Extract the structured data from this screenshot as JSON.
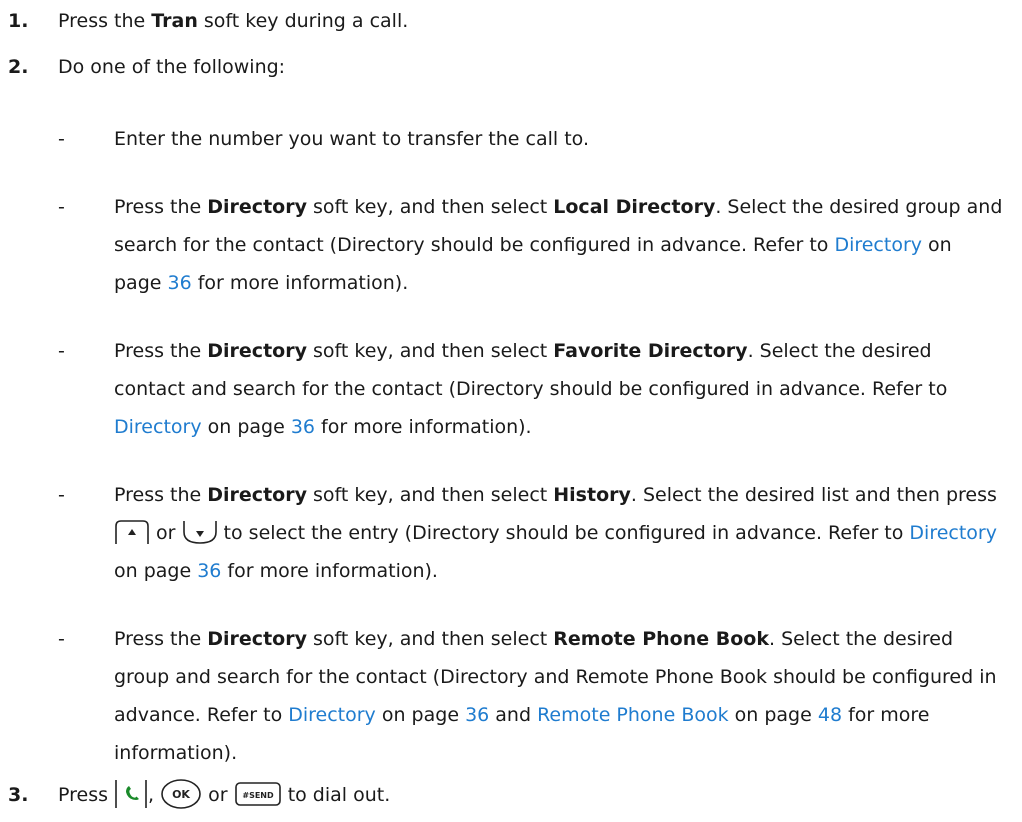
{
  "step1": {
    "num": "1.",
    "pre": "Press the ",
    "key": "Tran",
    "post": " soft key during a call."
  },
  "step2": {
    "num": "2.",
    "text": "Do one of the following:"
  },
  "subs": [
    {
      "dash": "-",
      "text": "Enter the number you want to transfer the call to."
    },
    {
      "dash": "-",
      "a": "Press the ",
      "b1": "Directory",
      "c": " soft key, and then select ",
      "b2": "Local Directory",
      "d": ". Select the desired group and search for the contact (Directory should be configured in advance. Refer to ",
      "link": "Directory",
      "e": " on page ",
      "page": "36",
      "f": " for more information)."
    },
    {
      "dash": "-",
      "a": "Press the ",
      "b1": "Directory",
      "c": " soft key, and then select ",
      "b2": "Favorite Directory",
      "d": ". Select the desired contact and search for the contact (Directory should be configured in advance. Refer to ",
      "link": "Directory",
      "e": " on page ",
      "page": "36",
      "f": " for more information)."
    },
    {
      "dash": "-",
      "a": "Press the ",
      "b1": "Directory",
      "c": " soft key, and then select ",
      "b2": "History",
      "d": ". Select the desired list and then press ",
      "or": " or ",
      "g": " to select the entry (Directory should be configured in advance. Refer to ",
      "link": "Directory",
      "e": " on page ",
      "page": "36",
      "f": " for more information)."
    },
    {
      "dash": "-",
      "a": "Press the ",
      "b1": "Directory",
      "c": " soft key, and then select ",
      "b2": "Remote Phone Book",
      "d": ". Select the desired group and search for the contact (Directory and Remote Phone Book should be configured in advance. Refer to ",
      "link": "Directory",
      "e": " on page ",
      "page": "36",
      "h": " and ",
      "link2": "Remote Phone Book",
      "e2": " on page ",
      "page2": "48",
      "f": " for more information)."
    }
  ],
  "step3": {
    "num": "3.",
    "pre": "Press ",
    "comma": ", ",
    "or": " or ",
    "post": " to dial out.",
    "ok_label": "OK",
    "send_label": "#SEND"
  }
}
